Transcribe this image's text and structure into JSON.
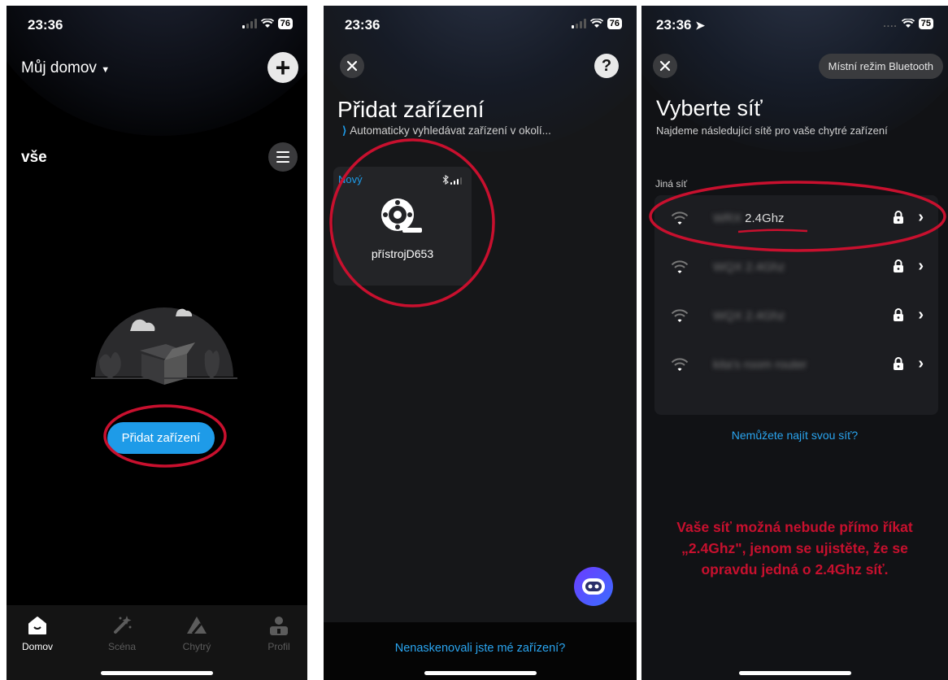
{
  "colors": {
    "accent": "#1e9be8",
    "annotation": "#c8102e"
  },
  "status": {
    "time_p1": "23:36",
    "time_p2": "23:36",
    "time_p3": "23:36",
    "battery_p1": "76",
    "battery_p2": "76",
    "battery_p3": "75"
  },
  "home": {
    "title": "Můj domov",
    "all_label": "vše",
    "add_button": "Přidat zařízení",
    "tabs": [
      {
        "label": "Domov",
        "icon": "home-icon"
      },
      {
        "label": "Scéna",
        "icon": "magic-wand-icon"
      },
      {
        "label": "Chytrý",
        "icon": "smart-icon"
      },
      {
        "label": "Profil",
        "icon": "profile-icon"
      }
    ]
  },
  "add_device": {
    "title": "Přidat zařízení",
    "scanning": "Automaticky vyhledávat zařízení v okolí...",
    "card_badge": "Nový",
    "device_name": "přístrojD653",
    "footer_link": "Nenaskenovali jste mé zařízení?"
  },
  "network": {
    "bluetooth_button": "Místní režim Bluetooth",
    "title": "Vyberte síť",
    "subtitle": "Najdeme následující sítě pro vaše chytré zařízení",
    "section_label": "Jiná síť",
    "networks": [
      {
        "prefix": "WRX",
        "name": "2.4Ghz"
      },
      {
        "prefix": "",
        "name": "WQX 2.4Ghz"
      },
      {
        "prefix": "",
        "name": "WQX 2.4Ghz"
      },
      {
        "prefix": "",
        "name": "kita's room router"
      }
    ],
    "cant_find": "Nemůžete najít svou síť?",
    "note_lines": [
      "Vaše síť možná nebude přímo říkat",
      "„2.4Ghz\", jenom se ujistěte, že se",
      "opravdu jedná o 2.4Ghz síť."
    ]
  }
}
